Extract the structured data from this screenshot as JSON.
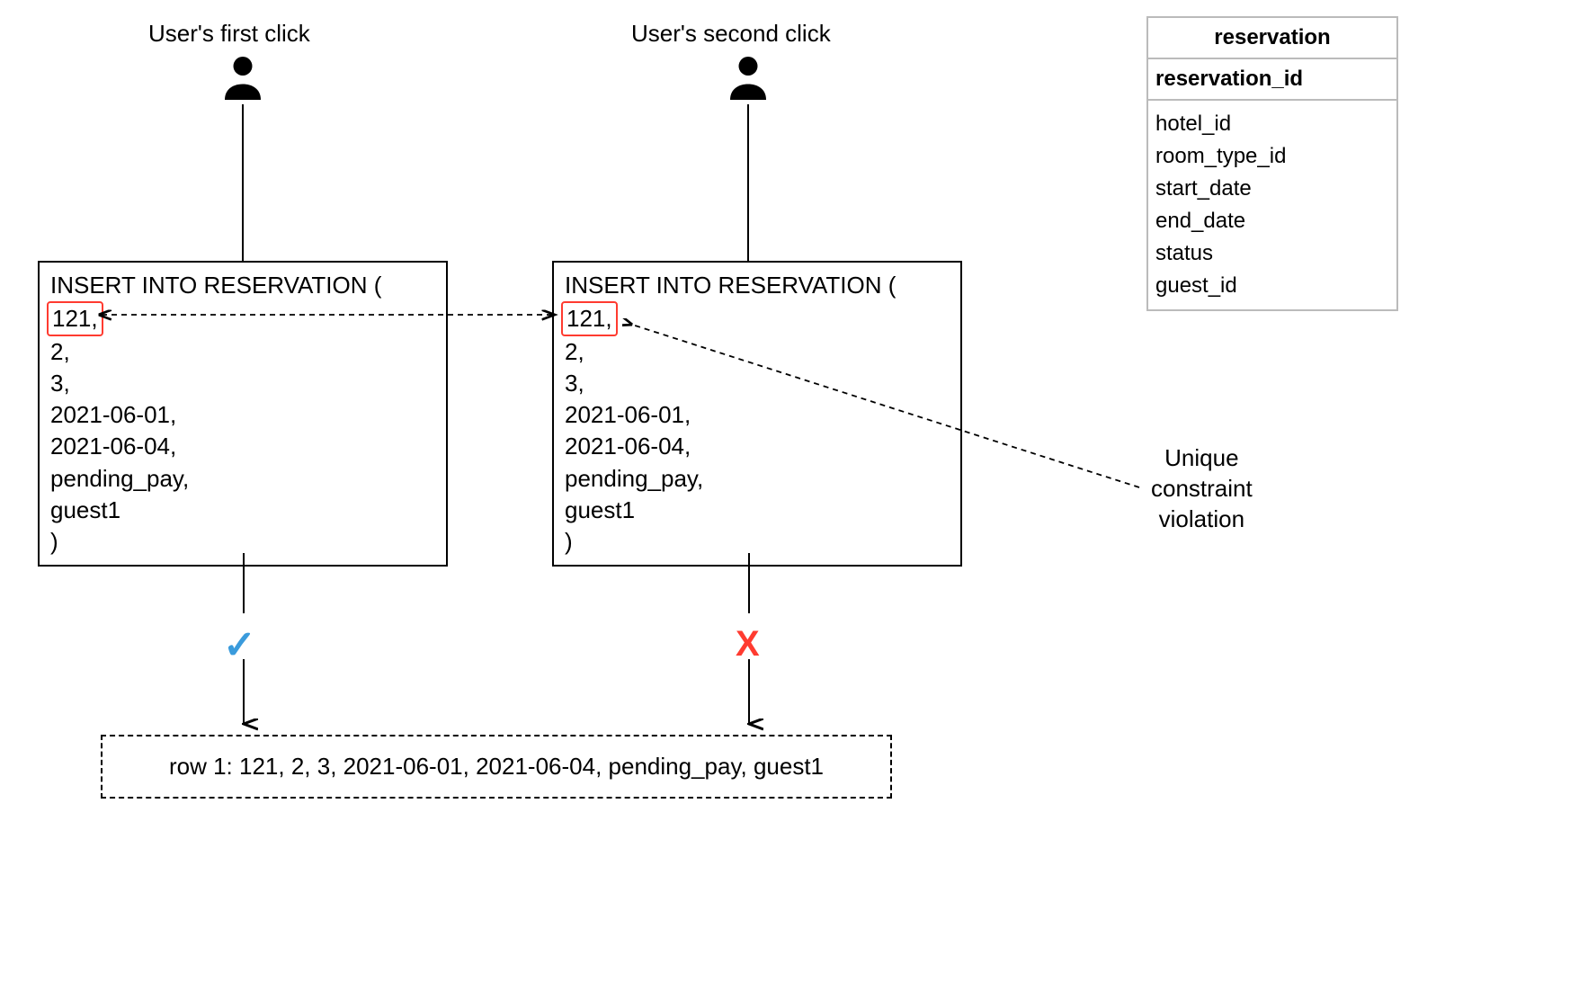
{
  "labels": {
    "first_click": "User's first click",
    "second_click": "User's second click"
  },
  "sql1": {
    "header": "INSERT INTO RESERVATION (",
    "val1": "121,",
    "val2": "2,",
    "val3": "3,",
    "val4": "2021-06-01,",
    "val5": "2021-06-04,",
    "val6": "pending_pay,",
    "val7": "guest1",
    "close": ")"
  },
  "sql2": {
    "header": "INSERT INTO RESERVATION (",
    "val1": "121,",
    "val2": "2,",
    "val3": "3,",
    "val4": "2021-06-01,",
    "val5": "2021-06-04,",
    "val6": "pending_pay,",
    "val7": "guest1",
    "close": ")"
  },
  "schema": {
    "title": "reservation",
    "pk": "reservation_id",
    "fields": [
      "hotel_id",
      "room_type_id",
      "start_date",
      "end_date",
      "status",
      "guest_id"
    ]
  },
  "result": {
    "text": "row 1: 121, 2, 3, 2021-06-01, 2021-06-04, pending_pay, guest1"
  },
  "annotation": {
    "unique_violation_l1": "Unique",
    "unique_violation_l2": "constraint",
    "unique_violation_l3": "violation"
  },
  "marks": {
    "check": "✓",
    "cross": "X"
  }
}
